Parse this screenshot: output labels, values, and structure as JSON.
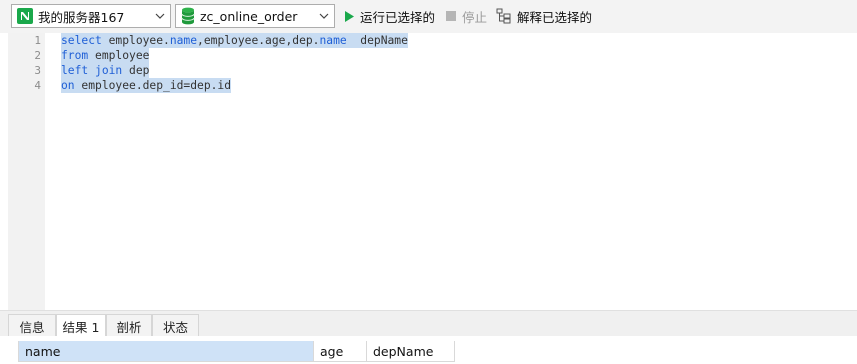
{
  "toolbar": {
    "server": "我的服务器167",
    "database": "zc_online_order",
    "run_selected": "运行已选择的",
    "stop": "停止",
    "explain_selected": "解释已选择的"
  },
  "editor": {
    "line_numbers": [
      "1",
      "2",
      "3",
      "4"
    ],
    "lines": [
      "select employee.name,employee.age,dep.name  depName",
      "from employee",
      "left join dep",
      "on employee.dep_id=dep.id"
    ]
  },
  "tabs": [
    "信息",
    "结果 1",
    "剖析",
    "状态"
  ],
  "active_tab": "结果 1",
  "result": {
    "columns": [
      "name",
      "age",
      "depName"
    ]
  },
  "colors": {
    "selection": "#c8dcf2",
    "keyword": "#1f5fd6",
    "run_icon": "#1aa84b",
    "header_selected": "#cfe2f7"
  }
}
